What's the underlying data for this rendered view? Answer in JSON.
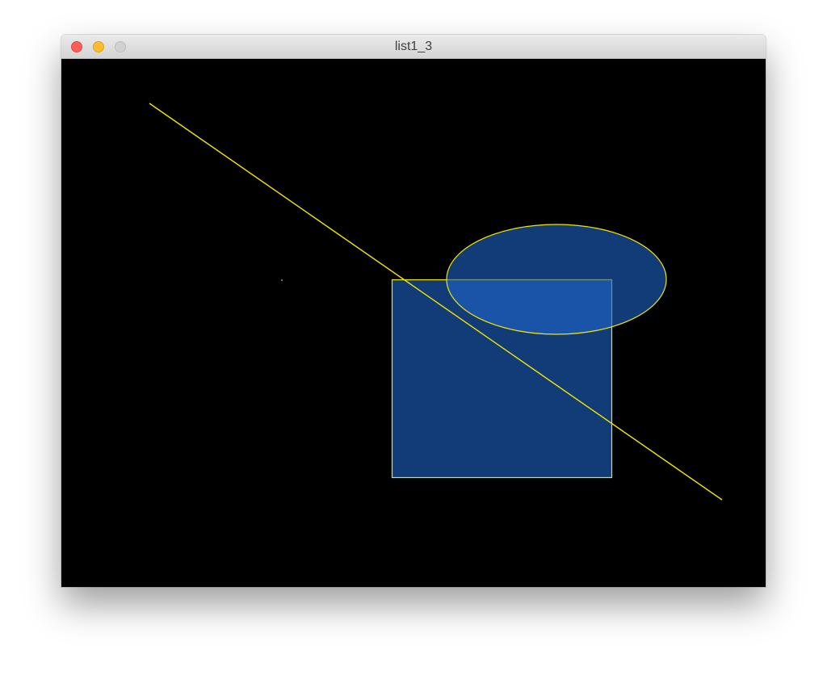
{
  "window": {
    "title": "list1_3",
    "controls": {
      "close_color": "#fd5f57",
      "minimize_color": "#febc2e",
      "zoom_color": "#d1d1d1"
    }
  },
  "canvas": {
    "background": "#000000",
    "stroke_color": "#f2e600",
    "fill_color": "#1e64c8",
    "fill_opacity": 0.6
  }
}
